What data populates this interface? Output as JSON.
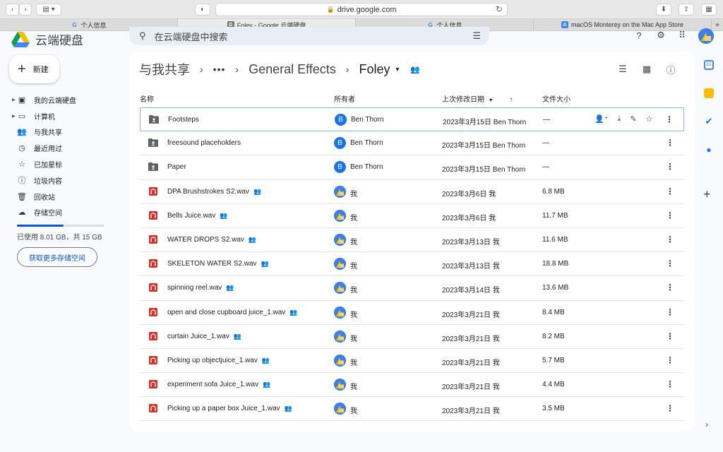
{
  "browser": {
    "url": "drive.google.com",
    "tabs": [
      {
        "label": "个人信息",
        "fav": "G",
        "fav_type": "g",
        "active": false
      },
      {
        "label": "Foley - Google 云端硬盘",
        "fav": "D",
        "fav_type": "d",
        "active": true
      },
      {
        "label": "个人信息",
        "fav": "G",
        "fav_type": "g",
        "active": false
      },
      {
        "label": "macOS Monterey on the Mac App Store",
        "fav": "A",
        "fav_type": "a",
        "active": false
      }
    ]
  },
  "header": {
    "app_name": "云端硬盘",
    "search_placeholder": "在云端硬盘中搜索"
  },
  "sidebar": {
    "new_label": "新建",
    "items": [
      {
        "label": "我的云端硬盘",
        "icon": "my-drive-icon",
        "glyph": "▣",
        "caret": true
      },
      {
        "label": "计算机",
        "icon": "computer-icon",
        "glyph": "▭",
        "caret": true
      },
      {
        "label": "与我共享",
        "icon": "shared-icon",
        "glyph": "👥",
        "caret": false
      },
      {
        "label": "最近用过",
        "icon": "clock-icon",
        "glyph": "◷",
        "caret": false
      },
      {
        "label": "已加星标",
        "icon": "star-icon",
        "glyph": "☆",
        "caret": false
      },
      {
        "label": "垃圾内容",
        "icon": "spam-icon",
        "glyph": "ⓘ",
        "caret": false
      },
      {
        "label": "回收站",
        "icon": "trash-icon",
        "glyph": "🗑",
        "caret": false
      },
      {
        "label": "存储空间",
        "icon": "cloud-icon",
        "glyph": "☁",
        "caret": false
      }
    ],
    "storage_text": "已使用 8.01 GB，共 15 GB",
    "storage_fraction": 0.534,
    "storage_button": "获取更多存储空间"
  },
  "breadcrumb": {
    "root": "与我共享",
    "middle": "General Effects",
    "current": "Foley"
  },
  "columns": {
    "name": "名称",
    "owner": "所有者",
    "modified": "上次修改日期",
    "size": "文件大小"
  },
  "files": [
    {
      "name": "Footsteps",
      "type": "folder",
      "shared": false,
      "owner": "Ben Thorn",
      "owner_initial": "B",
      "modified": "2023年3月15日 Ben Thorn",
      "size": "—",
      "selected": true
    },
    {
      "name": "freesound placeholders",
      "type": "folder",
      "shared": false,
      "owner": "Ben Thorn",
      "owner_initial": "B",
      "modified": "2023年3月15日 Ben Thorn",
      "size": "—",
      "selected": false
    },
    {
      "name": "Paper",
      "type": "folder",
      "shared": false,
      "owner": "Ben Thorn",
      "owner_initial": "B",
      "modified": "2023年3月15日 Ben Thorn",
      "size": "—",
      "selected": false
    },
    {
      "name": "DPA Brushstrokes S2.wav",
      "type": "audio",
      "shared": true,
      "owner": "我",
      "owner_initial": "",
      "modified": "2023年3月6日 我",
      "size": "6.8 MB",
      "selected": false
    },
    {
      "name": "Bells Juice.wav",
      "type": "audio",
      "shared": true,
      "owner": "我",
      "owner_initial": "",
      "modified": "2023年3月6日 我",
      "size": "11.7 MB",
      "selected": false
    },
    {
      "name": "WATER DROPS S2.wav",
      "type": "audio",
      "shared": true,
      "owner": "我",
      "owner_initial": "",
      "modified": "2023年3月13日 我",
      "size": "11.6 MB",
      "selected": false
    },
    {
      "name": "SKELETON WATER S2.wav",
      "type": "audio",
      "shared": true,
      "owner": "我",
      "owner_initial": "",
      "modified": "2023年3月13日 我",
      "size": "18.8 MB",
      "selected": false
    },
    {
      "name": "spinning reel.wav",
      "type": "audio",
      "shared": true,
      "owner": "我",
      "owner_initial": "",
      "modified": "2023年3月14日 我",
      "size": "13.6 MB",
      "selected": false
    },
    {
      "name": "open and close cupboard juice_1.wav",
      "type": "audio",
      "shared": true,
      "owner": "我",
      "owner_initial": "",
      "modified": "2023年3月21日 我",
      "size": "8.4 MB",
      "selected": false
    },
    {
      "name": "curtain Juice_1.wav",
      "type": "audio",
      "shared": true,
      "owner": "我",
      "owner_initial": "",
      "modified": "2023年3月21日 我",
      "size": "8.2 MB",
      "selected": false
    },
    {
      "name": "Picking up objectjuice_1.wav",
      "type": "audio",
      "shared": true,
      "owner": "我",
      "owner_initial": "",
      "modified": "2023年3月21日 我",
      "size": "5.7 MB",
      "selected": false
    },
    {
      "name": "experiment sofa Juice_1.wav",
      "type": "audio",
      "shared": true,
      "owner": "我",
      "owner_initial": "",
      "modified": "2023年3月21日 我",
      "size": "4.4 MB",
      "selected": false
    },
    {
      "name": "Picking up a paper box Juice_1.wav",
      "type": "audio",
      "shared": true,
      "owner": "我",
      "owner_initial": "",
      "modified": "2023年3月21日 我",
      "size": "3.5 MB",
      "selected": false
    }
  ],
  "colors": {
    "accent": "#0b57d0",
    "folder": "#5f6368",
    "audio": "#d93025"
  }
}
